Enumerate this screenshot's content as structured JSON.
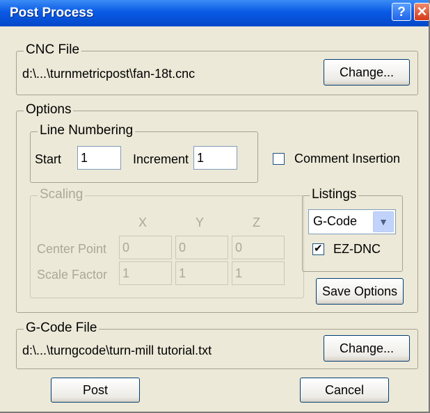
{
  "window": {
    "title": "Post Process",
    "help_symbol": "?",
    "close_symbol": "✕"
  },
  "cnc_file": {
    "legend": "CNC File",
    "path": "d:\\...\\turnmetricpost\\fan-18t.cnc",
    "change_label": "Change..."
  },
  "options": {
    "legend": "Options",
    "line_numbering": {
      "legend": "Line Numbering",
      "start_label": "Start",
      "start_value": "1",
      "increment_label": "Increment",
      "increment_value": "1"
    },
    "comment_insertion": {
      "label": "Comment Insertion",
      "checked": false
    },
    "scaling": {
      "legend": "Scaling",
      "enabled": false,
      "columns": [
        "X",
        "Y",
        "Z"
      ],
      "center_point_label": "Center Point",
      "center_point_values": [
        "0",
        "0",
        "0"
      ],
      "scale_factor_label": "Scale Factor",
      "scale_factor_values": [
        "1",
        "1",
        "1"
      ]
    },
    "listings": {
      "legend": "Listings",
      "selected": "G-Code",
      "ez_dnc_label": "EZ-DNC",
      "ez_dnc_checked": true
    },
    "save_options_label": "Save Options"
  },
  "gcode_file": {
    "legend": "G-Code File",
    "path": "d:\\...\\turngcode\\turn-mill tutorial.txt",
    "change_label": "Change..."
  },
  "footer": {
    "post_label": "Post",
    "cancel_label": "Cancel"
  },
  "colors": {
    "titlebar": "#0a5ae6",
    "dialog_bg": "#ece9d8",
    "disabled_text": "#aca899",
    "button_border": "#003c74"
  }
}
